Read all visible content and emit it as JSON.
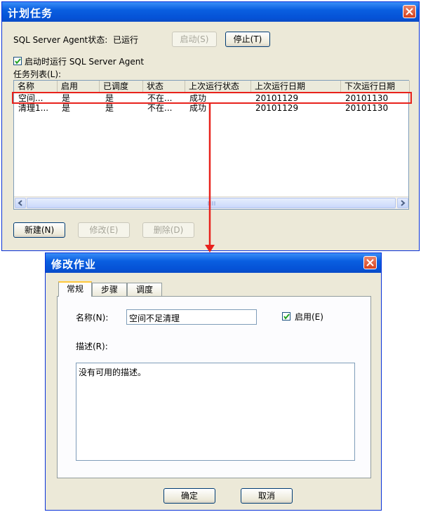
{
  "schedule_window": {
    "title": "计划任务",
    "agent_status_label": "SQL Server Agent状态:",
    "agent_status_value": "已运行",
    "start_button": "启动(S)",
    "stop_button": "停止(T)",
    "autostart_label": "启动时运行 SQL Server Agent",
    "autostart_checked": true,
    "task_list_label": "任务列表(L):",
    "columns": [
      "名称",
      "启用",
      "已调度",
      "状态",
      "上次运行状态",
      "上次运行日期",
      "下次运行日期"
    ],
    "rows": [
      [
        "空间...",
        "是",
        "是",
        "不在...",
        "成功",
        "20101129",
        "20101130"
      ],
      [
        "清理1...",
        "是",
        "是",
        "不在...",
        "成功",
        "20101129",
        "20101130"
      ]
    ],
    "new_button": "新建(N)",
    "edit_button": "修改(E)",
    "delete_button": "删除(D)"
  },
  "edit_job_window": {
    "title": "修改作业",
    "tabs": [
      "常规",
      "步骤",
      "调度"
    ],
    "active_tab": "常规",
    "name_label": "名称(N):",
    "name_value": "空间不足清理",
    "enabled_label": "启用(E)",
    "enabled_checked": true,
    "description_label": "描述(R):",
    "description_value": "没有可用的描述。",
    "ok_button": "确定",
    "cancel_button": "取消"
  },
  "highlight_color": "#e8221c"
}
